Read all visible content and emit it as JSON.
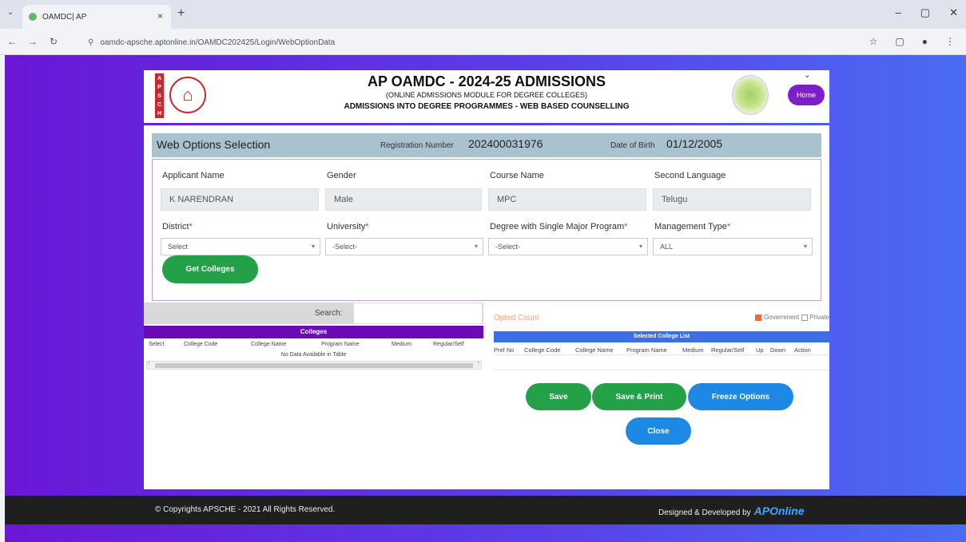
{
  "browser": {
    "tab_title": "OAMDC| AP",
    "tab_close": "×",
    "new_tab": "+",
    "tab_menu": "⌄",
    "url": "oamdc-apsche.aptonline.in/OAMDC202425/Login/WebOptionData",
    "win_min": "–",
    "win_max": "▢",
    "win_close": "✕"
  },
  "header": {
    "title": "AP OAMDC - 2024-25 ADMISSIONS",
    "subtitle1": "(ONLINE ADMISSIONS MODULE FOR DEGREE COLLEGES)",
    "subtitle2": "ADMISSIONS INTO DEGREE PROGRAMMES - WEB BASED COUNSELLING",
    "logo_letters": [
      "A",
      "P",
      "S",
      "C",
      "H",
      "E"
    ],
    "home_label": "Home"
  },
  "web_options": {
    "title": "Web Options Selection",
    "reg_label": "Registration Number",
    "reg_value": "202400031976",
    "dob_label": "Date of Birth",
    "dob_value": "01/12/2005"
  },
  "form": {
    "applicant_label": "Applicant Name",
    "applicant_value": "K NARENDRAN",
    "gender_label": "Gender",
    "gender_value": "Male",
    "course_label": "Course Name",
    "course_value": "MPC",
    "second_lang_label": "Second Language",
    "second_lang_value": "Telugu",
    "district_label": "District",
    "district_value": "Select",
    "university_label": "University",
    "university_value": "-Select-",
    "degree_label": "Degree with Single Major Program",
    "degree_value": "-Select-",
    "management_label": "Management Type",
    "management_value": "ALL",
    "required_mark": "*",
    "get_colleges": "Get Colleges"
  },
  "colleges": {
    "search_label": "Search:",
    "bar_title": "Colleges",
    "columns": [
      "Select",
      "College Code",
      "College Name",
      "Program Name",
      "Medium",
      "Regular/Self"
    ],
    "empty": "No Data Available in Table"
  },
  "selected": {
    "opted_count": "Opted Count",
    "legend_gov": "Government",
    "legend_pvt": "Private",
    "bar_title": "Selected College List",
    "columns": [
      "Pref No",
      "College Code",
      "College Name",
      "Program Name",
      "Medium",
      "Regular/Self",
      "Up",
      "Down",
      "Action"
    ]
  },
  "actions": {
    "save": "Save",
    "save_print": "Save & Print",
    "freeze": "Freeze Options",
    "close": "Close"
  },
  "footer": {
    "copyright": "© Copyrights APSCHE - 2021 All Rights Reserved.",
    "designed": "Designed & Developed by",
    "brand": "APOnline"
  }
}
